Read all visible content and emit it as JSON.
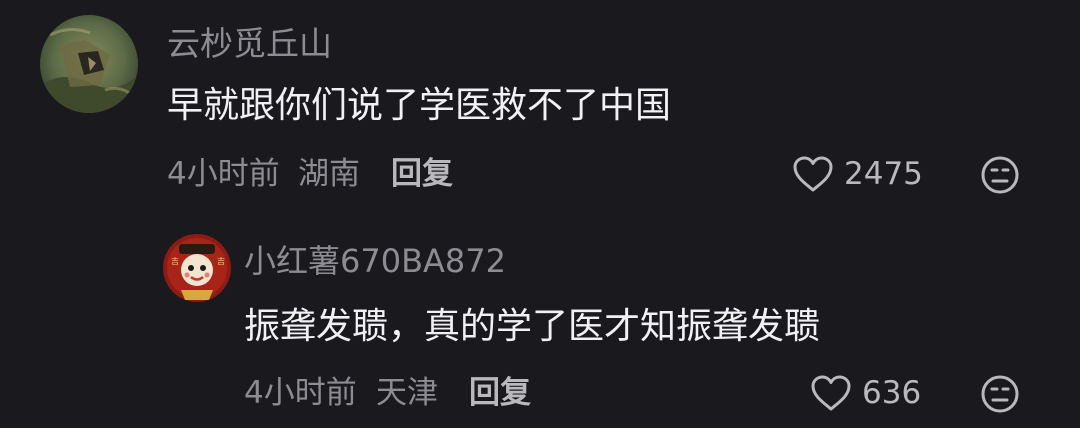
{
  "comments": [
    {
      "username": "云杪觅丘山",
      "text": "早就跟你们说了学医救不了中国",
      "time": "4小时前",
      "location": "湖南",
      "reply_label": "回复",
      "likes": "2475",
      "avatar_icon": "avatar-landscape-painting",
      "like_icon": "heart-outline-icon",
      "dislike_icon": "meh-face-icon"
    },
    {
      "username": "小红薯670BA872",
      "text": "振聋发聩，真的学了医才知振聋发聩",
      "time": "4小时前",
      "location": "天津",
      "reply_label": "回复",
      "likes": "636",
      "avatar_icon": "avatar-cartoon-character",
      "like_icon": "heart-outline-icon",
      "dislike_icon": "meh-face-icon"
    }
  ],
  "colors": {
    "background": "#1a191e",
    "primary_text": "#f1f0f3",
    "secondary_text": "#8d8c93"
  }
}
